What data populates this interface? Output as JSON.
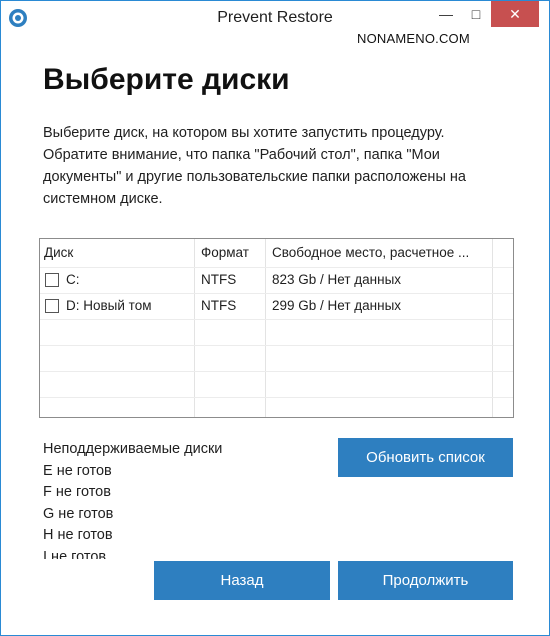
{
  "window": {
    "title": "Prevent Restore",
    "minimize_glyph": "—",
    "maximize_glyph": "□",
    "close_glyph": "✕",
    "watermark": "NONAMENO.COM",
    "app_icon": "target-icon",
    "accent_color": "#2e7fc0",
    "close_color": "#c75050"
  },
  "page": {
    "heading": "Выберите диски",
    "description": "Выберите диск, на котором вы хотите запустить процедуру. Обратите внимание, что папка \"Рабочий стол\", папка \"Мои документы\" и другие пользовательские папки расположены на системном диске."
  },
  "table": {
    "columns": [
      "Диск",
      "Формат",
      "Свободное место, расчетное ..."
    ],
    "rows": [
      {
        "disk": "C:",
        "format": "NTFS",
        "free": "823 Gb / Нет данных",
        "checked": false
      },
      {
        "disk": "D: Новый том",
        "format": "NTFS",
        "free": "299 Gb / Нет данных",
        "checked": false
      }
    ]
  },
  "unsupported": {
    "title": "Неподдерживаемые диски",
    "items": [
      "E не готов",
      "F не готов",
      "G не готов",
      "H не готов",
      "I не готов"
    ]
  },
  "buttons": {
    "refresh": "Обновить список",
    "back": "Назад",
    "next": "Продолжить"
  }
}
